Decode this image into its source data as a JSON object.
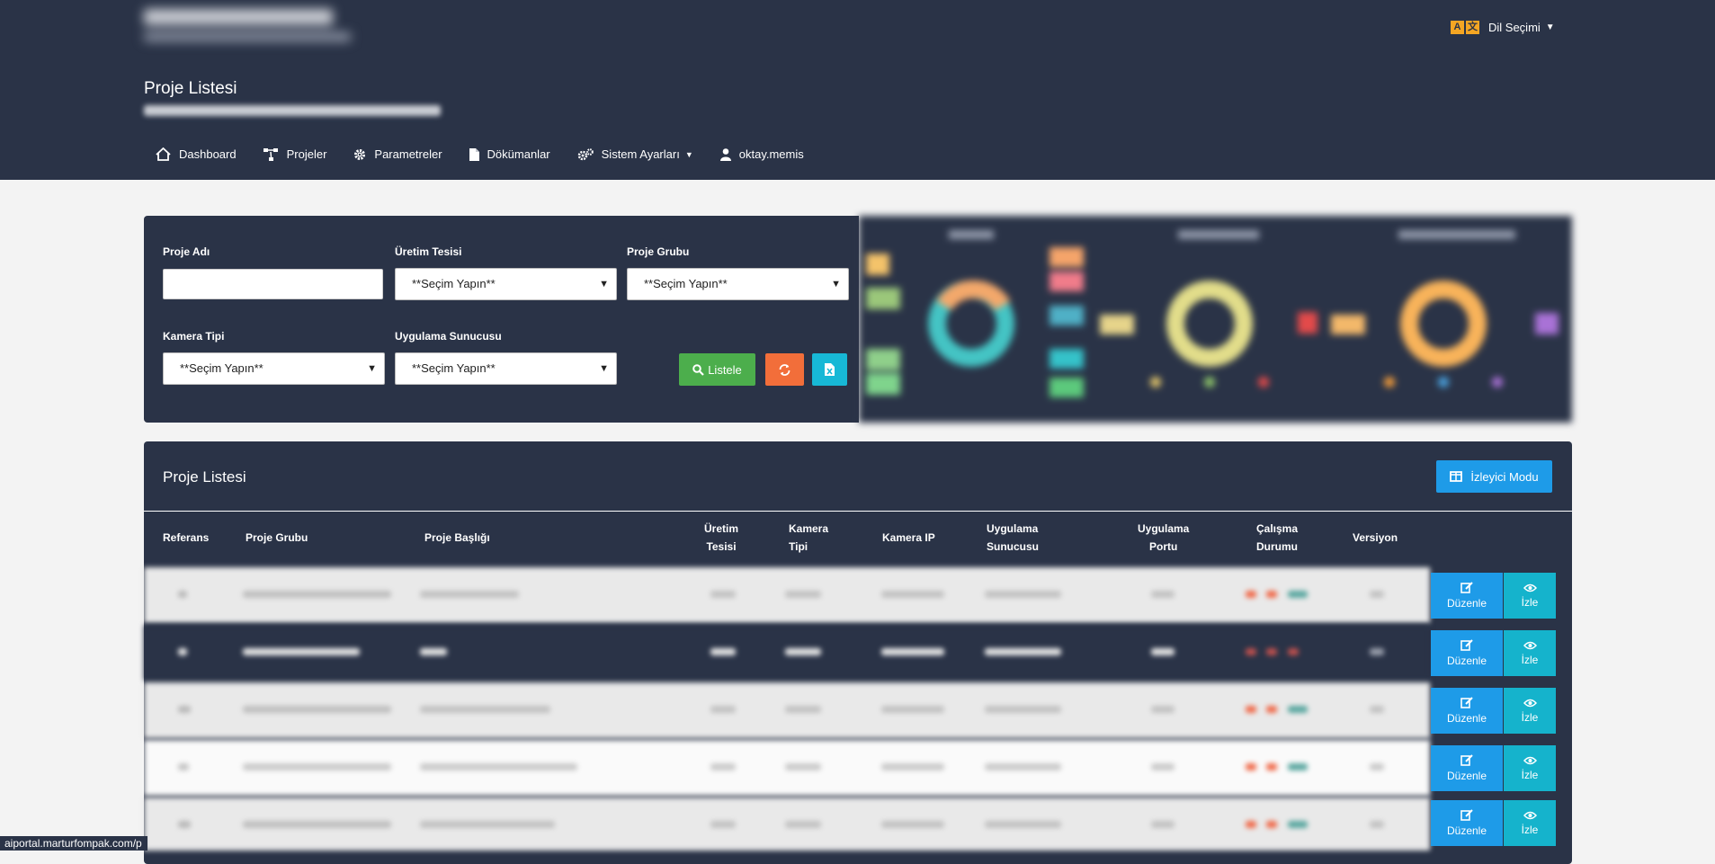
{
  "header": {
    "language_label": "Dil Seçimi",
    "page_title": "Proje Listesi"
  },
  "nav": {
    "items": [
      {
        "label": "Dashboard",
        "icon": "home-icon"
      },
      {
        "label": "Projeler",
        "icon": "sitemap-icon"
      },
      {
        "label": "Parametreler",
        "icon": "gear-icon"
      },
      {
        "label": "Dökümanlar",
        "icon": "document-icon"
      },
      {
        "label": "Sistem Ayarları",
        "icon": "gears-icon"
      },
      {
        "label": "oktay.memis",
        "icon": "user-icon"
      }
    ]
  },
  "filters": {
    "project_name_label": "Proje Adı",
    "project_name_value": "",
    "facility_label": "Üretim Tesisi",
    "facility_value": "**Seçim Yapın**",
    "group_label": "Proje Grubu",
    "group_value": "**Seçim Yapın**",
    "camera_type_label": "Kamera Tipi",
    "camera_type_value": "**Seçim Yapın**",
    "app_server_label": "Uygulama Sunucusu",
    "app_server_value": "**Seçim Yapın**",
    "list_button": "Listele"
  },
  "list": {
    "title": "Proje Listesi",
    "viewer_mode_button": "İzleyici Modu",
    "columns": {
      "ref": "Referans",
      "group": "Proje Grubu",
      "title": "Proje Başlığı",
      "facility_1": "Üretim",
      "facility_2": "Tesisi",
      "camtype_1": "Kamera",
      "camtype_2": "Tipi",
      "camip": "Kamera IP",
      "server_1": "Uygulama",
      "server_2": "Sunucusu",
      "port_1": "Uygulama",
      "port_2": "Portu",
      "status_1": "Çalışma",
      "status_2": "Durumu",
      "version": "Versiyon"
    },
    "edit_label": "Düzenle",
    "view_label": "İzle"
  },
  "statusbar": {
    "url": "aiportal.marturfompak.com/p"
  },
  "colors": {
    "header_bg": "#2a3347",
    "page_bg": "#f3f3f3",
    "accent_blue": "#1e9be8",
    "accent_cyan": "#15b3cc",
    "green": "#4cae4c",
    "orange": "#f26e3a",
    "lang_icon": "#f5a623"
  }
}
